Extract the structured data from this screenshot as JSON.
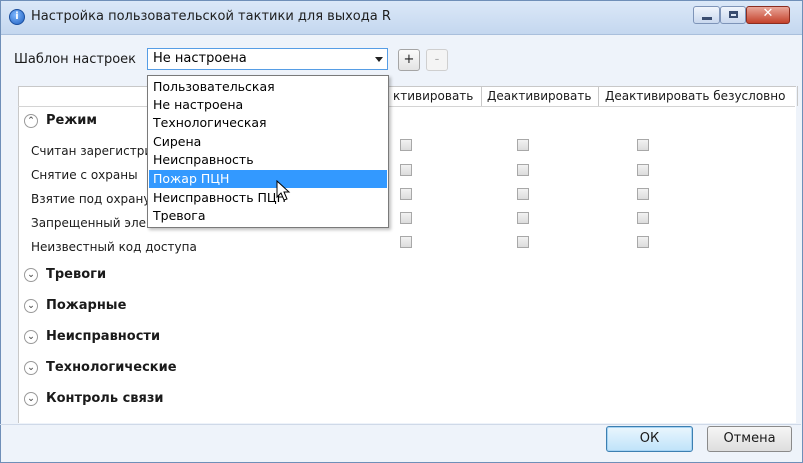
{
  "window": {
    "title": "Настройка пользовательской тактики для выхода R",
    "close_symbol": "✕"
  },
  "template": {
    "label": "Шаблон настроек",
    "selected": "Не настроена",
    "add_label": "+",
    "remove_label": "-"
  },
  "columns": {
    "activate_partial": "ктивировать",
    "deactivate": "Деактивировать",
    "deactivate_unconditional": "Деактивировать безусловно"
  },
  "groups": {
    "mode": "Режим",
    "alarms": "Тревоги",
    "fire": "Пожарные",
    "faults": "Неисправности",
    "tech": "Технологические",
    "link": "Контроль связи"
  },
  "rows": [
    "Считан зарегистри",
    "Снятие с охраны",
    "Взятие под охрану",
    "Запрещенный эле",
    "Неизвестный код доступа"
  ],
  "dropdown": {
    "options": [
      "Пользовательская",
      "Не настроена",
      "Технологическая",
      "Сирена",
      "Неисправность",
      "Пожар ПЦН",
      "Неисправность ПЦН",
      "Тревога"
    ],
    "highlighted": "Пожар ПЦН"
  },
  "footer": {
    "ok": "ОК",
    "cancel": "Отмена"
  },
  "icons": {
    "app": "app-icon",
    "expander_up": "chevron-up-icon",
    "expander_down": "chevron-down-icon"
  },
  "colors": {
    "selection": "#3399ff",
    "titlebar": "#c4d7ef",
    "close_button": "#c4412a"
  }
}
